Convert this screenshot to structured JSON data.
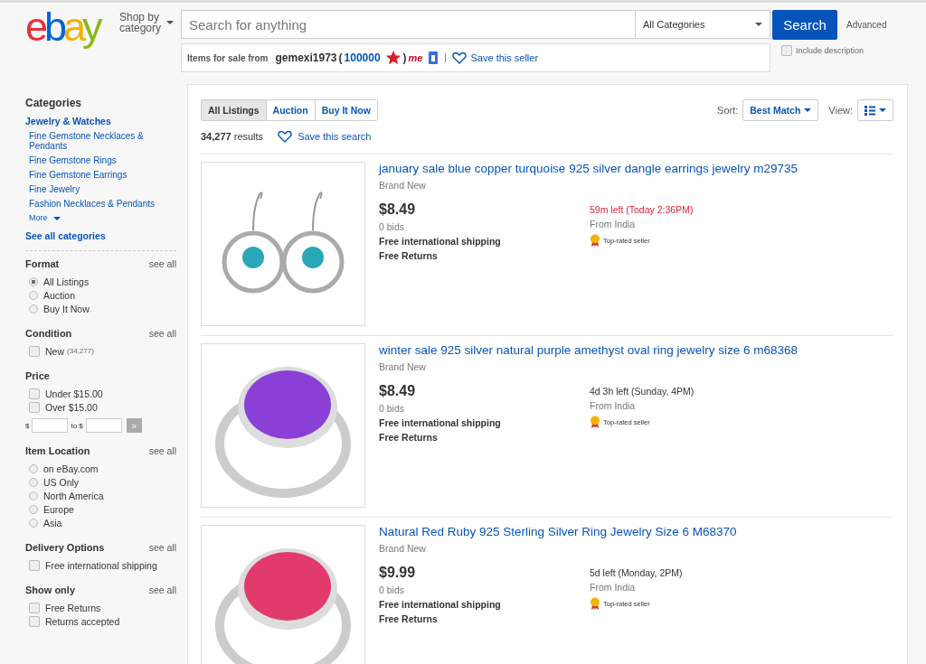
{
  "header": {
    "logo": "ebay",
    "shop_by": "Shop by category",
    "search_placeholder": "Search for anything",
    "category": "All Categories",
    "search_button": "Search",
    "advanced": "Advanced",
    "include_description": {
      "label": "Include description",
      "checked": false
    }
  },
  "seller_bar": {
    "prefix": "Items for sale from",
    "seller": "gemexi1973",
    "open_paren": "(",
    "score": "100000",
    "close_paren": ")",
    "me_badge": "me",
    "save": "Save this seller"
  },
  "sidebar": {
    "categories": {
      "title": "Categories",
      "parent": "Jewelry & Watches",
      "items": [
        "Fine Gemstone Necklaces & Pendants",
        "Fine Gemstone Rings",
        "Fine Gemstone Earrings",
        "Fine Jewelry",
        "Fashion Necklaces & Pendants"
      ],
      "more": "More",
      "see_all": "See all categories"
    },
    "filters": [
      {
        "title": "Format",
        "see_all": "see all",
        "kind": "radio",
        "options": [
          {
            "label": "All Listings",
            "selected": true
          },
          {
            "label": "Auction",
            "selected": false
          },
          {
            "label": "Buy It Now",
            "selected": false
          }
        ]
      },
      {
        "title": "Condition",
        "see_all": "see all",
        "kind": "checkbox",
        "options": [
          {
            "label": "New",
            "count": "(34,277)",
            "checked": false
          }
        ]
      },
      {
        "title": "Price",
        "kind": "checkbox",
        "options": [
          {
            "label": "Under $15.00",
            "checked": false
          },
          {
            "label": "Over $15.00",
            "checked": false
          }
        ],
        "range": {
          "from_label": "$",
          "to_label": "to $",
          "go": "»"
        }
      },
      {
        "title": "Item Location",
        "see_all": "see all",
        "kind": "radio",
        "options": [
          {
            "label": "on eBay.com",
            "selected": false
          },
          {
            "label": "US Only",
            "selected": false
          },
          {
            "label": "North America",
            "selected": false
          },
          {
            "label": "Europe",
            "selected": false
          },
          {
            "label": "Asia",
            "selected": false
          }
        ]
      },
      {
        "title": "Delivery Options",
        "see_all": "see all",
        "kind": "checkbox",
        "options": [
          {
            "label": "Free international shipping",
            "checked": false
          }
        ]
      },
      {
        "title": "Show only",
        "see_all": "see all",
        "kind": "checkbox",
        "options": [
          {
            "label": "Free Returns",
            "checked": false
          },
          {
            "label": "Returns accepted",
            "checked": false
          }
        ]
      }
    ]
  },
  "results": {
    "tabs": [
      {
        "label": "All Listings",
        "selected": true
      },
      {
        "label": "Auction",
        "selected": false
      },
      {
        "label": "Buy It Now",
        "selected": false
      }
    ],
    "sort_label": "Sort:",
    "sort": "Best Match",
    "view_label": "View:",
    "count": "**34,277** results",
    "save_search": "Save this search",
    "listings": [
      {
        "title": "january sale blue copper turquoise 925 silver dangle earrings jewelry m29735",
        "kind": "earrings",
        "color": "#2aa7b8",
        "condition": "Brand New",
        "price": "$8.49",
        "bids": "0 bids",
        "shipping": "Free international shipping",
        "returns": "Free Returns",
        "time_left": "59m left (Today 2:36PM)",
        "ending_soon": true,
        "location": "From India",
        "badge": "Top-rated seller"
      },
      {
        "title": "winter sale 925 silver natural purple amethyst oval ring jewelry size 6 m68368",
        "kind": "ring",
        "color": "#8a3fd6",
        "condition": "Brand New",
        "price": "$8.49",
        "bids": "0 bids",
        "shipping": "Free international shipping",
        "returns": "Free Returns",
        "time_left": "4d 3h left (Sunday, 4PM)",
        "ending_soon": false,
        "location": "From India",
        "badge": "Top-rated seller"
      },
      {
        "title": "Natural Red Ruby 925 Sterling Silver Ring Jewelry Size 6 M68370",
        "kind": "ring",
        "color": "#e23a6c",
        "condition": "Brand New",
        "price": "$9.99",
        "bids": "0 bids",
        "shipping": "Free international shipping",
        "returns": "Free Returns",
        "time_left": "5d left (Monday, 2PM)",
        "ending_soon": false,
        "location": "From India",
        "badge": "Top-rated seller"
      }
    ]
  }
}
